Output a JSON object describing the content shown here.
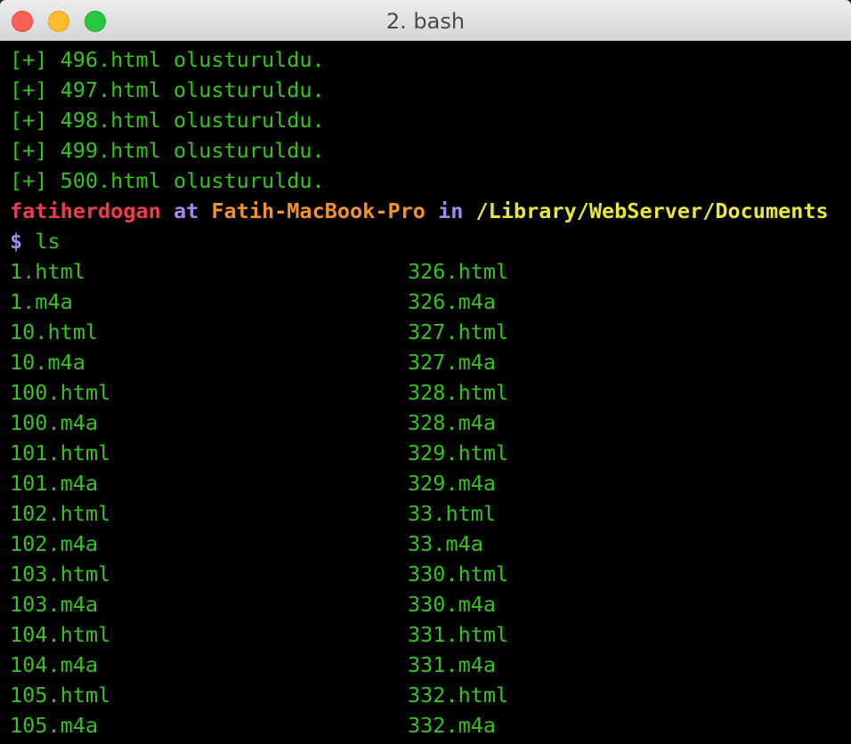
{
  "window": {
    "title": "2. bash"
  },
  "terminal": {
    "created_lines": [
      "[+] 496.html olusturuldu.",
      "[+] 497.html olusturuldu.",
      "[+] 498.html olusturuldu.",
      "[+] 499.html olusturuldu.",
      "[+] 500.html olusturuldu."
    ],
    "prompt_line": {
      "user": "fatiherdogan",
      "at": "at",
      "host": "Fatih-MacBook-Pro",
      "in": "in",
      "path": "/Library/WebServer/Documents"
    },
    "command_line": {
      "prompt_symbol": "$",
      "command": "ls"
    },
    "listing": {
      "left": [
        "1.html",
        "1.m4a",
        "10.html",
        "10.m4a",
        "100.html",
        "100.m4a",
        "101.html",
        "101.m4a",
        "102.html",
        "102.m4a",
        "103.html",
        "103.m4a",
        "104.html",
        "104.m4a",
        "105.html",
        "105.m4a"
      ],
      "right": [
        "326.html",
        "326.m4a",
        "327.html",
        "327.m4a",
        "328.html",
        "328.m4a",
        "329.html",
        "329.m4a",
        "33.html",
        "33.m4a",
        "330.html",
        "330.m4a",
        "331.html",
        "331.m4a",
        "332.html",
        "332.m4a"
      ]
    }
  },
  "colors": {
    "output_green": "#35c41d",
    "user_red": "#f03b4c",
    "keyword_purple": "#a788f2",
    "host_orange": "#f0932b",
    "path_yellow": "#e8e83a",
    "background": "#000000"
  }
}
